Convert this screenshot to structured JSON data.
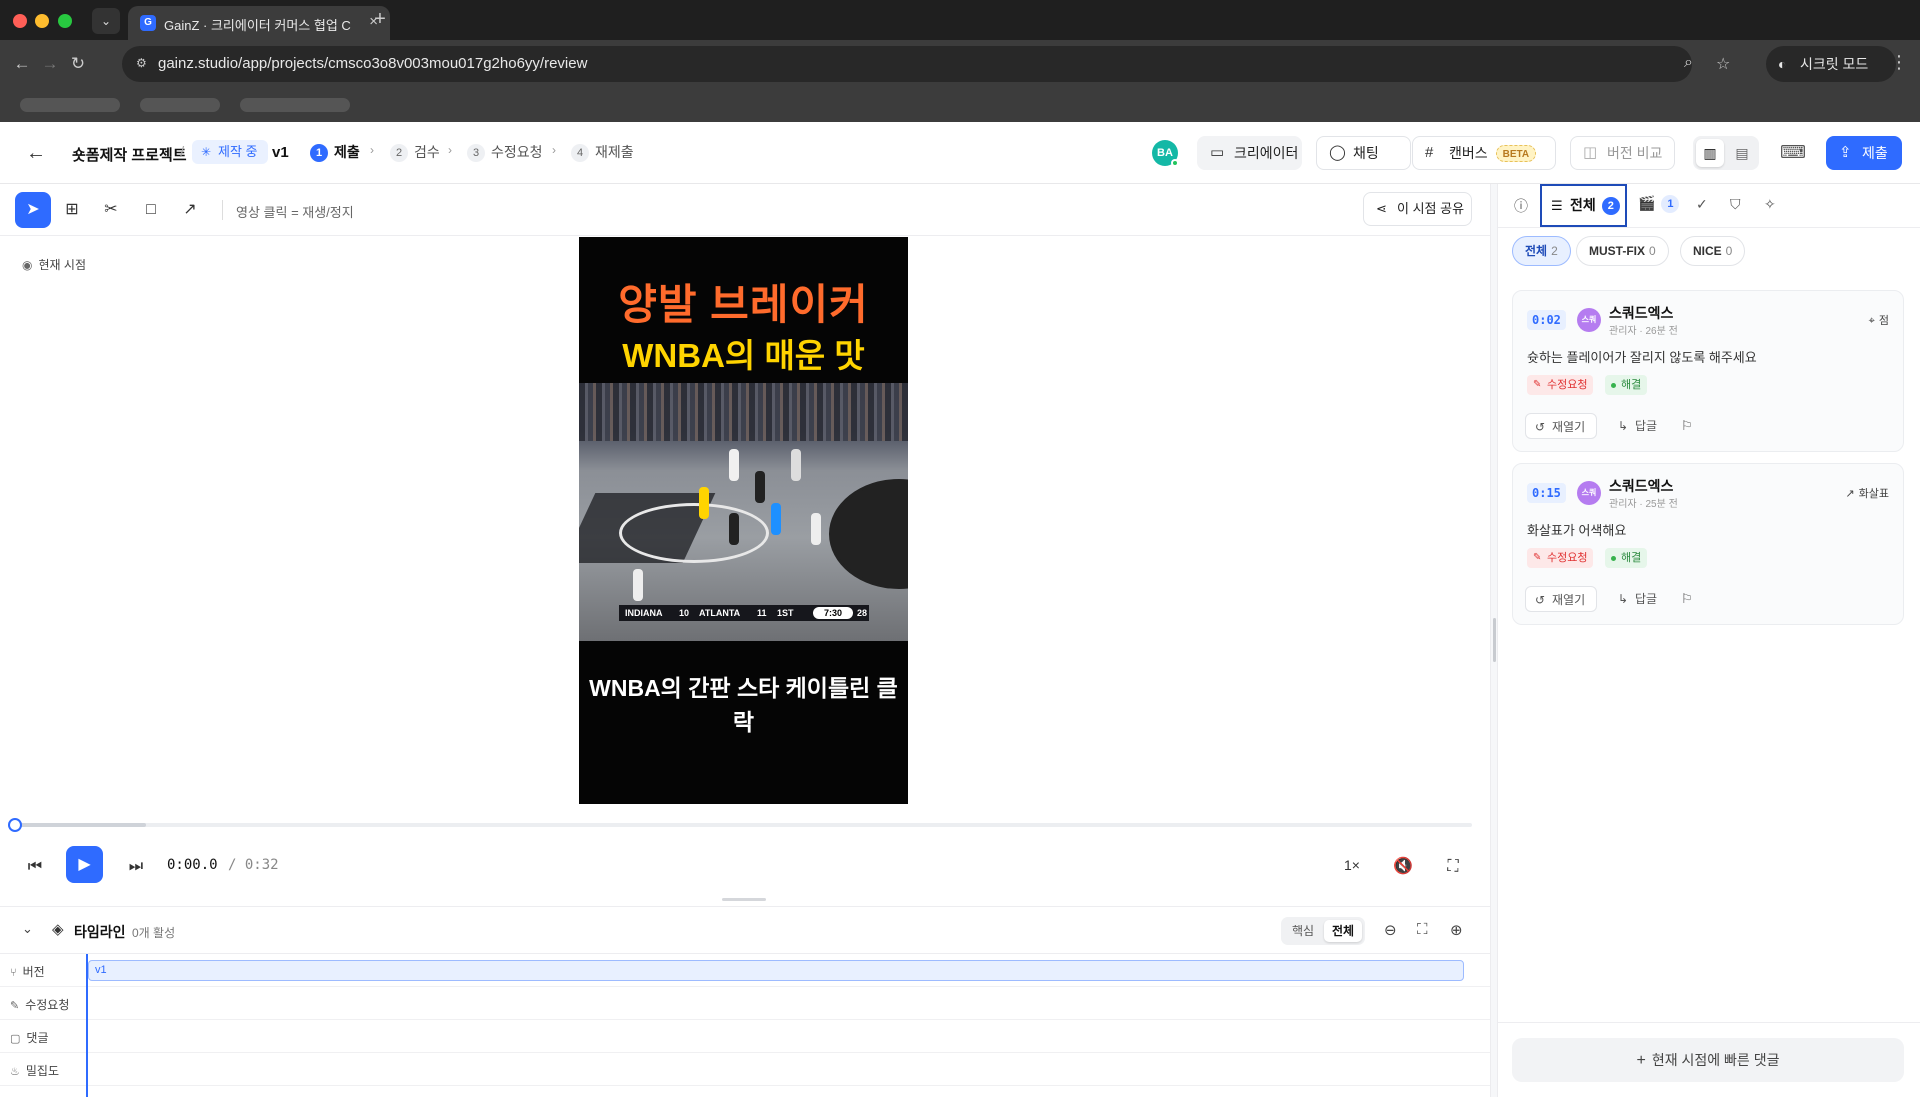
{
  "browser": {
    "tab_title": "GainZ · 크리에이터 커머스 협업 C",
    "tab_favicon": "G",
    "url": "gainz.studio/app/projects/cmsco3o8v003mou017g2ho6yy/review",
    "incognito_label": "시크릿 모드"
  },
  "header": {
    "project_name": "숏폼제작 프로젝트",
    "breadcrumb_sep": "/",
    "status": "제작 중",
    "version": "v1",
    "steps": [
      {
        "num": "1",
        "label": "제출"
      },
      {
        "num": "2",
        "label": "검수"
      },
      {
        "num": "3",
        "label": "수정요청"
      },
      {
        "num": "4",
        "label": "재제출"
      }
    ],
    "avatar_initials": "BA",
    "creator_btn": "크리에이터",
    "chat_btn": "채팅",
    "canvas_btn": "캔버스",
    "canvas_badge": "BETA",
    "compare_btn": "버전 비교",
    "submit_btn": "제출"
  },
  "toolbar": {
    "hint": "영상 클릭 = 재생/정지",
    "share_btn": "이 시점 공유"
  },
  "stage": {
    "current_time_label": "현재 시점"
  },
  "video": {
    "title_line1": "양발 브레이커",
    "title_line2": "WNBA의 매운 맛",
    "subtitle": "WNBA의 간판 스타 케이틀린 클락",
    "score_team1": "INDIANA",
    "score_1": "10",
    "score_team2": "ATLANTA",
    "score_2": "11",
    "quarter": "1ST",
    "clock": "7:30",
    "shot_clock": "28"
  },
  "player": {
    "time_current": "0:00.0",
    "time_total": "/ 0:32",
    "speed": "1×",
    "progress_fraction": 0.0
  },
  "timeline": {
    "title": "타임라인",
    "active_count": "0개 활성",
    "seg_core": "핵심",
    "seg_all": "전체",
    "rows": [
      {
        "label": "버전"
      },
      {
        "label": "수정요청"
      },
      {
        "label": "댓글"
      },
      {
        "label": "밀집도"
      }
    ],
    "version_bar_label": "v1"
  },
  "panel": {
    "tab_all_label": "전체",
    "tab_all_count": "2",
    "tab_scenes_count": "1",
    "filters": [
      {
        "label": "전체",
        "count": "2"
      },
      {
        "label": "MUST-FIX",
        "count": "0"
      },
      {
        "label": "NICE",
        "count": "0"
      }
    ],
    "comments": [
      {
        "time": "0:02",
        "avatar": "스쿼",
        "author": "스쿼드엑스",
        "meta": "관리자 · 26분 전",
        "tag": "점",
        "body": "슛하는 플레이어가 잘리지 않도록 해주세요",
        "status_red": "수정요청",
        "status_green": "해결",
        "reopen": "재열기",
        "reply": "답글"
      },
      {
        "time": "0:15",
        "avatar": "스쿼",
        "author": "스쿼드엑스",
        "meta": "관리자 · 25분 전",
        "tag": "화살표",
        "body": "화살표가 어색해요",
        "status_red": "수정요청",
        "status_green": "해결",
        "reopen": "재열기",
        "reply": "답글"
      }
    ],
    "quick_comment": "현재 시점에 빠른 댓글"
  },
  "colors": {
    "accent": "#2f6bff",
    "must_fix": "#e03131",
    "resolved": "#2b8a3e"
  }
}
